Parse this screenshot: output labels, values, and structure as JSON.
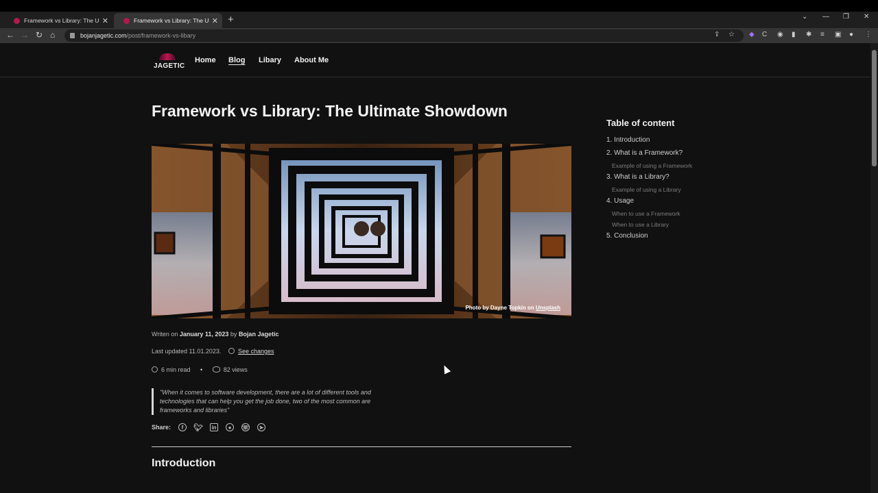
{
  "browser": {
    "tabs": [
      {
        "title": "Framework vs Library: The Ultim",
        "close": "✕"
      },
      {
        "title": "Framework vs Library: The Ultim",
        "close": "✕"
      }
    ],
    "new_tab": "+",
    "url_host": "bojanjagetic.com",
    "url_path": "/post/framework-vs-libary",
    "window_controls": [
      "⌄",
      "—",
      "❐",
      "✕"
    ]
  },
  "site": {
    "logo_text": "JAGETIC",
    "nav": [
      {
        "label": "Home"
      },
      {
        "label": "Blog"
      },
      {
        "label": "Libary"
      },
      {
        "label": "About Me"
      }
    ]
  },
  "post": {
    "title": "Framework vs Library: The Ultimate Showdown",
    "photo_credit_prefix": "Photo by Dayne Topkin on ",
    "photo_credit_link": "Unsplash",
    "written_prefix": "Writen on ",
    "written_date": "January 11, 2023",
    "written_by": " by ",
    "author": "Bojan Jagetic",
    "updated": "Last updated 11.01.2023.",
    "see_changes": "See changes",
    "read_time": "6 min read",
    "separator": "•",
    "views": "82 views",
    "quote": "\"When it comes to software development, there are a lot of different tools and technologies that can help you get the job done, two of the most common are frameworks and libraries\"",
    "share_label": "Share:",
    "share_icons": [
      "facebook-icon",
      "twitter-icon",
      "linkedin-icon",
      "reddit-icon",
      "viber-icon",
      "telegram-icon"
    ],
    "section_heading": "Introduction"
  },
  "toc": {
    "title": "Table of content",
    "items": [
      {
        "label": "1. Introduction",
        "level": 1
      },
      {
        "label": "2. What is a Framework?",
        "level": 1
      },
      {
        "label": "Example of using a Framework",
        "level": 2
      },
      {
        "label": "3. What is a Library?",
        "level": 1
      },
      {
        "label": "Example of using a Library",
        "level": 2
      },
      {
        "label": "4. Usage",
        "level": 1
      },
      {
        "label": "When to use a Framework",
        "level": 2
      },
      {
        "label": "When to use a Library",
        "level": 2
      },
      {
        "label": "5. Conclusion",
        "level": 1
      }
    ]
  },
  "colors": {
    "page_bg": "#111111",
    "brand": "#c0144e"
  }
}
